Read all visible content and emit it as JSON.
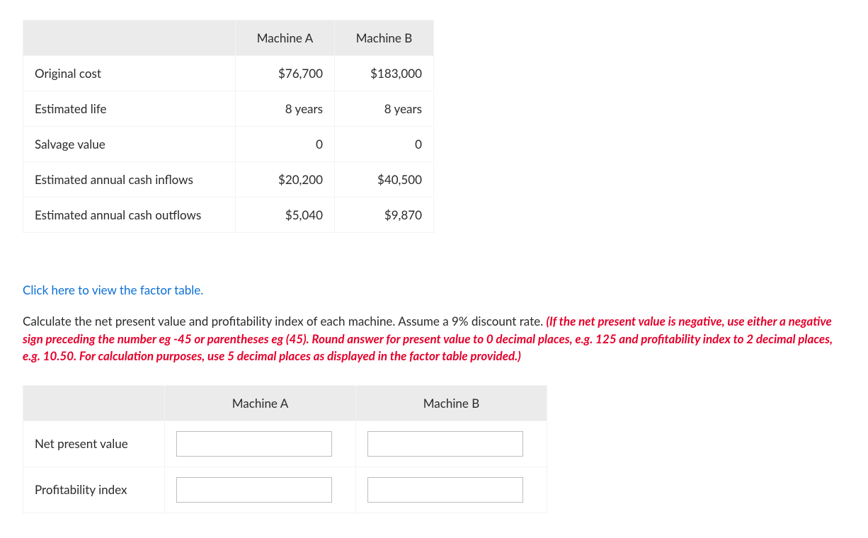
{
  "table1": {
    "col_a": "Machine A",
    "col_b": "Machine B",
    "rows": {
      "r0": {
        "label": "Original cost",
        "a": "$76,700",
        "b": "$183,000"
      },
      "r1": {
        "label": "Estimated life",
        "a": "8 years",
        "b": "8 years"
      },
      "r2": {
        "label": "Salvage value",
        "a": "0",
        "b": "0"
      },
      "r3": {
        "label": "Estimated annual cash inflows",
        "a": "$20,200",
        "b": "$40,500"
      },
      "r4": {
        "label": "Estimated annual cash outflows",
        "a": "$5,040",
        "b": "$9,870"
      }
    }
  },
  "link_text": "Click here to view the factor table.",
  "instruction_plain": "Calculate the net present value and profitability index of each machine. Assume a 9% discount rate. ",
  "instruction_red": "(If the net present value is negative, use either a negative sign preceding the number eg -45 or parentheses eg (45). Round answer for present value to 0 decimal places, e.g. 125 and profitability index to 2 decimal places, e.g. 10.50. For calculation purposes, use 5 decimal places as displayed in the factor table provided.)",
  "table2": {
    "col_a": "Machine A",
    "col_b": "Machine B",
    "rows": {
      "npv": {
        "label": "Net present value"
      },
      "pi": {
        "label": "Profitability index"
      }
    }
  }
}
